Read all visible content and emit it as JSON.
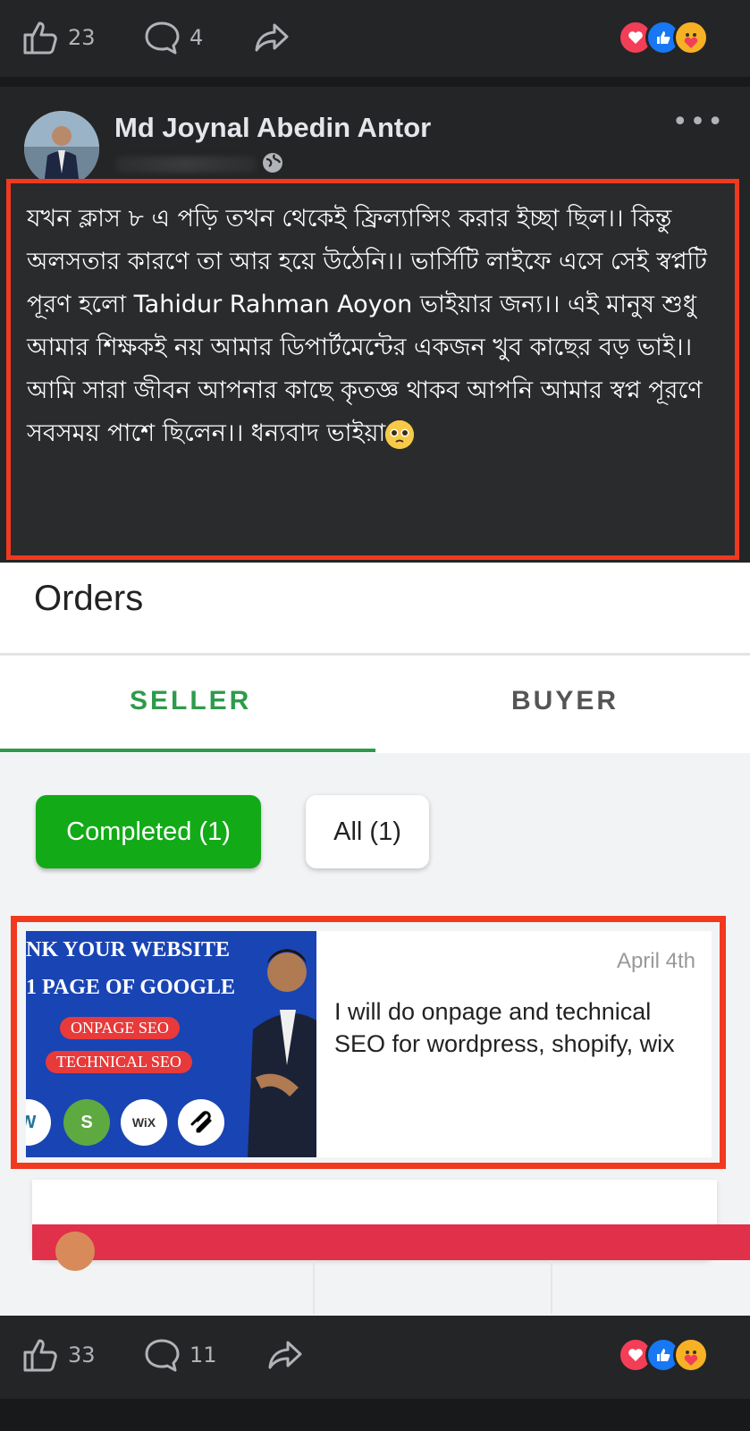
{
  "top_bar": {
    "like_count": "23",
    "comment_count": "4"
  },
  "post": {
    "author": "Md Joynal Abedin Antor",
    "text": "যখন ক্লাস ৮ এ পড়ি তখন থেকেই ফ্রিল্যান্সিং করার ইচ্ছা ছিল।। কিন্তু অলসতার কারণে তা আর হয়ে উঠেনি।। ভার্সিটি লাইফে এসে সেই স্বপ্নটি পূরণ হলো Tahidur Rahman Aoyon ভাইয়ার জন্য।। এই মানুষ শুধু আমার শিক্ষকই নয় আমার ডিপার্টমেন্টের একজন খুব কাছের বড় ভাই।। আমি সারা জীবন আপনার কাছে কৃতজ্ঞ থাকব আপনি আমার স্বপ্ন পূরণে সবসময় পাশে ছিলেন।। ধন্যবাদ ভাইয়া",
    "highlight_color": "#f0391f"
  },
  "orders": {
    "title": "Orders",
    "tabs": [
      {
        "label": "SELLER",
        "active": true
      },
      {
        "label": "BUYER",
        "active": false
      }
    ],
    "filters": [
      {
        "label": "Completed (1)",
        "active": true
      },
      {
        "label": "All (1)",
        "active": false
      }
    ],
    "accent_color": "#2e9b4b",
    "order": {
      "date": "April 4th",
      "title": "I will do onpage and technical SEO for wordpress, shopify, wix",
      "thumbnail": {
        "line1": "NK YOUR WEBSITE",
        "line2": "1 PAGE OF GOOGLE",
        "pill1": "ONPAGE SEO",
        "pill2": "TECHNICAL SEO",
        "icons": [
          "wordpress-icon",
          "shopify-icon",
          "wix-icon",
          "squarespace-icon"
        ]
      }
    }
  },
  "bottom_bar": {
    "like_count": "33",
    "comment_count": "11"
  }
}
